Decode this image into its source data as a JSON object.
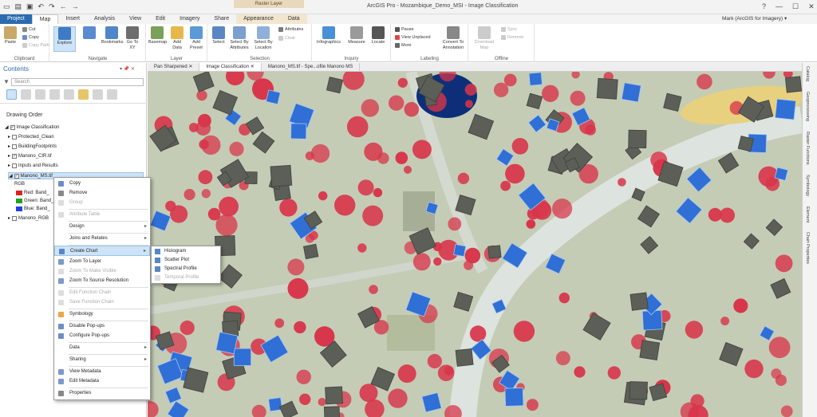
{
  "titlebar": {
    "contextual_header": "Raster Layer",
    "app_title": "ArcGIS Pro - Mozambique_Demo_MSI - Image Classification",
    "user": "Mark (ArcGIS for Imagery)",
    "user_suffix": "▾",
    "help": "?",
    "minimize": "—",
    "maximize": "☐",
    "close": "✕"
  },
  "ribbon_tabs": [
    "Project",
    "Map",
    "Insert",
    "Analysis",
    "View",
    "Edit",
    "Imagery",
    "Share",
    "Appearance",
    "Data"
  ],
  "ribbon": {
    "clipboard": {
      "label": "Clipboard",
      "paste": "Paste",
      "cut": "Cut",
      "copy": "Copy",
      "copy_path": "Copy Path"
    },
    "navigate": {
      "label": "Navigate",
      "explore": "Explore",
      "bookmarks": "Bookmarks",
      "goto": "Go To XY"
    },
    "layer": {
      "label": "Layer",
      "basemap": "Basemap",
      "add_data": "Add Data",
      "add_preset": "Add Preset"
    },
    "selection": {
      "label": "Selection",
      "select": "Select",
      "by_attributes": "Select By Attributes",
      "by_location": "Select By Location",
      "attributes": "Attributes",
      "clear": "Clear"
    },
    "inquiry": {
      "label": "Inquiry",
      "infographics": "Infographics",
      "measure": "Measure",
      "locate": "Locate"
    },
    "labeling": {
      "label": "Labeling",
      "pause": "Pause",
      "view_unplaced": "View Unplaced",
      "more": "More",
      "convert": "Convert To Annotation"
    },
    "offline": {
      "label": "Offline",
      "download_map": "Download Map",
      "sync": "Sync",
      "remove": "Remove"
    }
  },
  "contents": {
    "title": "Contents",
    "pin": "▾ 📌 ✕",
    "search_placeholder": "Search",
    "drawing_order": "Drawing Order",
    "layers": [
      {
        "name": "Image Classification",
        "checked": true
      },
      {
        "name": "Protected_Clean",
        "checked": false
      },
      {
        "name": "BuildingFootprints",
        "checked": false
      },
      {
        "name": "Manono_CIR.tif",
        "checked": true
      },
      {
        "name": "Inputs and Results",
        "checked": false
      },
      {
        "name": "Manono_MS.tif",
        "checked": true
      }
    ],
    "rgb_label": "RGB",
    "bands": [
      {
        "name": "Red: Band_",
        "color": "#e02020"
      },
      {
        "name": "Green: Band_",
        "color": "#20a020"
      },
      {
        "name": "Blue: Band_",
        "color": "#2040e0"
      }
    ],
    "last_layer": "Manono_RGB"
  },
  "map_tabs": [
    "Pan Sharpened",
    "Image Classification",
    "Manono_MS.tif - Spe...ofile Manono MS"
  ],
  "map_tab_close": "✕",
  "right_tabs": [
    "Catalog",
    "Geoprocessing",
    "Raster Functions",
    "Symbology",
    "Element",
    "Chart Properties"
  ],
  "context_menu": {
    "items": [
      {
        "label": "Copy",
        "disabled": false,
        "arrow": false
      },
      {
        "label": "Remove",
        "disabled": false,
        "arrow": false
      },
      {
        "label": "Group",
        "disabled": true,
        "arrow": false
      },
      {
        "label": "Attribute Table",
        "disabled": true,
        "arrow": false
      },
      {
        "label": "Design",
        "disabled": false,
        "arrow": true
      },
      {
        "label": "Joins and Relates",
        "disabled": false,
        "arrow": true
      },
      {
        "label": "Create Chart",
        "disabled": false,
        "arrow": true,
        "highlight": true
      },
      {
        "label": "Zoom To Layer",
        "disabled": false,
        "arrow": false
      },
      {
        "label": "Zoom To Make Visible",
        "disabled": true,
        "arrow": false
      },
      {
        "label": "Zoom To Source Resolution",
        "disabled": false,
        "arrow": false
      },
      {
        "label": "Edit Function Chain",
        "disabled": true,
        "arrow": false
      },
      {
        "label": "Save Function Chain",
        "disabled": true,
        "arrow": false
      },
      {
        "label": "Symbology",
        "disabled": false,
        "arrow": false
      },
      {
        "label": "Disable Pop-ups",
        "disabled": false,
        "arrow": false
      },
      {
        "label": "Configure Pop-ups",
        "disabled": false,
        "arrow": false
      },
      {
        "label": "Data",
        "disabled": false,
        "arrow": true
      },
      {
        "label": "Sharing",
        "disabled": false,
        "arrow": true
      },
      {
        "label": "View Metadata",
        "disabled": false,
        "arrow": false
      },
      {
        "label": "Edit Metadata",
        "disabled": false,
        "arrow": false
      },
      {
        "label": "Properties",
        "disabled": false,
        "arrow": false
      }
    ],
    "arrow_glyph": "▸"
  },
  "submenu": {
    "items": [
      {
        "label": "Histogram",
        "disabled": false
      },
      {
        "label": "Scatter Plot",
        "disabled": false
      },
      {
        "label": "Spectral Profile",
        "disabled": false
      },
      {
        "label": "Temporal Profile",
        "disabled": true
      }
    ]
  },
  "colors": {
    "accent": "#2b6cb0",
    "vegetation": "#d8354a",
    "roof_blue": "#2f6fd6",
    "ground": "#c4ccb5",
    "road": "#dde3de",
    "water": "#0d2f7a",
    "field": "#e7d07e"
  }
}
